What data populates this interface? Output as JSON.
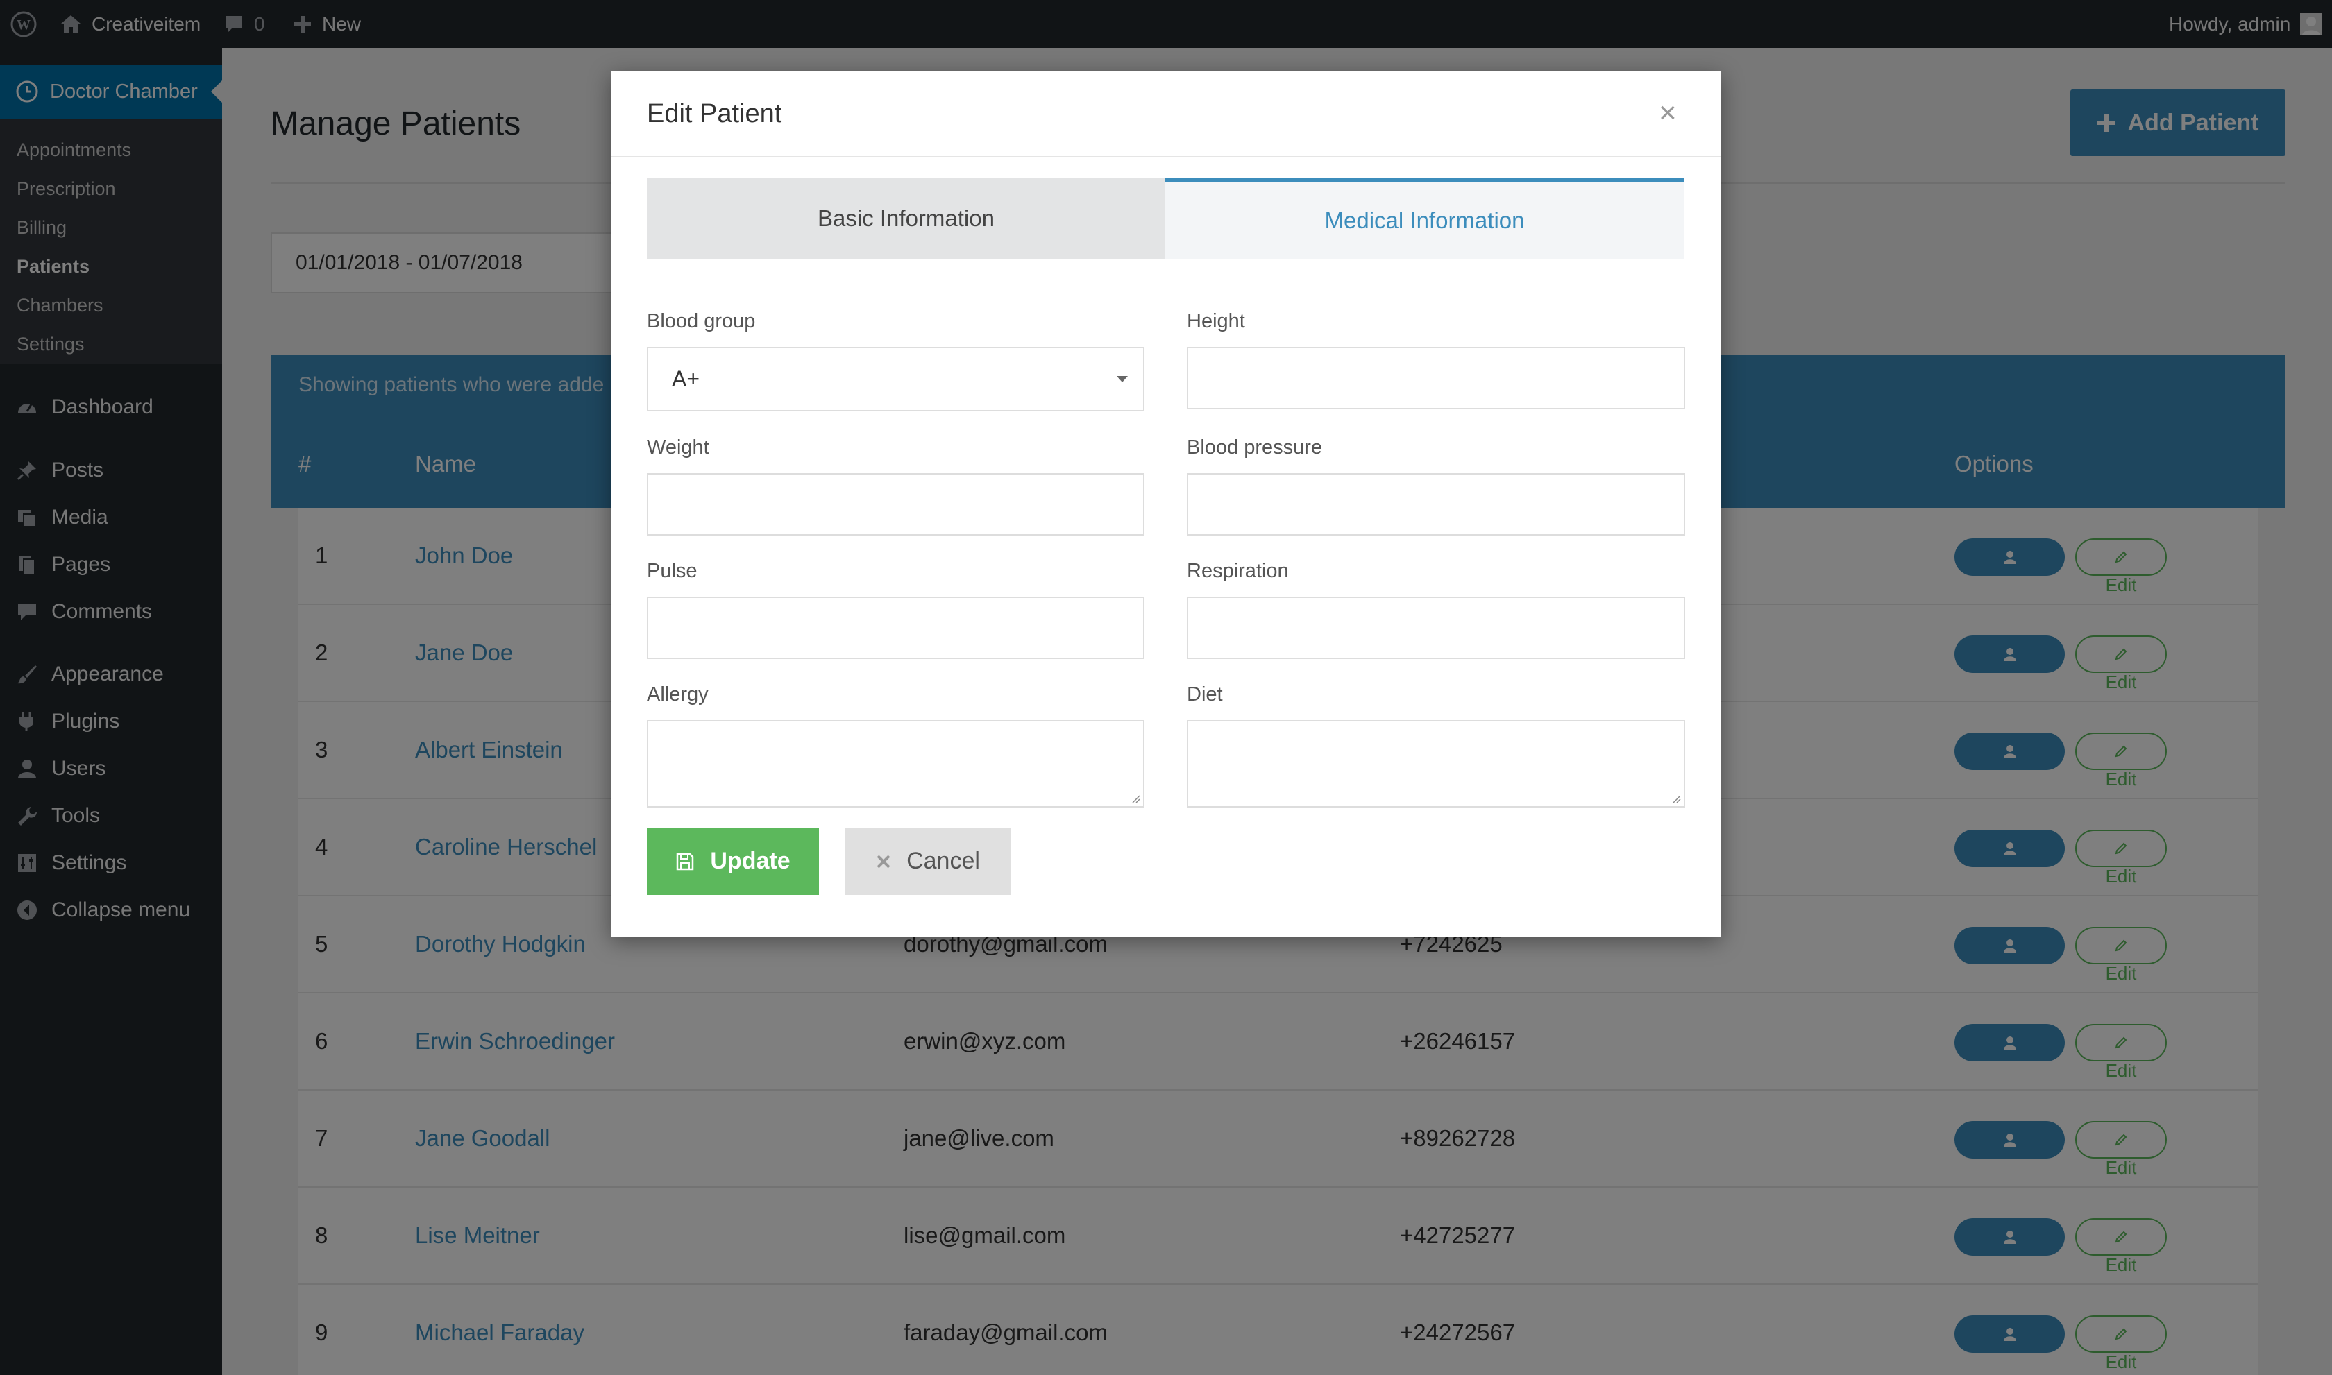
{
  "admin_bar": {
    "site_name": "Creativeitem",
    "comments_count": "0",
    "new_label": "New",
    "howdy": "Howdy, admin"
  },
  "sidebar": {
    "current_plugin": "Doctor Chamber",
    "submenu": [
      "Appointments",
      "Prescription",
      "Billing",
      "Patients",
      "Chambers",
      "Settings"
    ],
    "active_submenu": "Patients",
    "menu": {
      "dashboard": "Dashboard",
      "posts": "Posts",
      "media": "Media",
      "pages": "Pages",
      "comments": "Comments",
      "appearance": "Appearance",
      "plugins": "Plugins",
      "users": "Users",
      "tools": "Tools",
      "settings": "Settings",
      "collapse": "Collapse menu"
    }
  },
  "page": {
    "title": "Manage Patients",
    "add_button": "Add Patient",
    "date_range": "01/01/2018 - 01/07/2018",
    "banner_text": "Showing patients who were adde",
    "columns": {
      "num": "#",
      "name": "Name",
      "options": "Options"
    },
    "profile_label": "Profile",
    "edit_label": "Edit",
    "rows": [
      {
        "num": "1",
        "name": "John Doe",
        "email": "",
        "phone": ""
      },
      {
        "num": "2",
        "name": "Jane Doe",
        "email": "",
        "phone": ""
      },
      {
        "num": "3",
        "name": "Albert Einstein",
        "email": "",
        "phone": ""
      },
      {
        "num": "4",
        "name": "Caroline Herschel",
        "email": "",
        "phone": ""
      },
      {
        "num": "5",
        "name": "Dorothy Hodgkin",
        "email": "dorothy@gmail.com",
        "phone": "+7242625"
      },
      {
        "num": "6",
        "name": "Erwin Schroedinger",
        "email": "erwin@xyz.com",
        "phone": "+26246157"
      },
      {
        "num": "7",
        "name": "Jane Goodall",
        "email": "jane@live.com",
        "phone": "+89262728"
      },
      {
        "num": "8",
        "name": "Lise Meitner",
        "email": "lise@gmail.com",
        "phone": "+42725277"
      },
      {
        "num": "9",
        "name": "Michael Faraday",
        "email": "faraday@gmail.com",
        "phone": "+24272567"
      }
    ]
  },
  "modal": {
    "title": "Edit Patient",
    "close_symbol": "×",
    "tabs": {
      "basic": "Basic Information",
      "medical": "Medical Information"
    },
    "active_tab": "Medical Information",
    "fields": {
      "blood_group_label": "Blood group",
      "blood_group_value": "A+",
      "height_label": "Height",
      "weight_label": "Weight",
      "blood_pressure_label": "Blood pressure",
      "pulse_label": "Pulse",
      "respiration_label": "Respiration",
      "allergy_label": "Allergy",
      "diet_label": "Diet"
    },
    "update_label": "Update",
    "cancel_label": "Cancel"
  }
}
